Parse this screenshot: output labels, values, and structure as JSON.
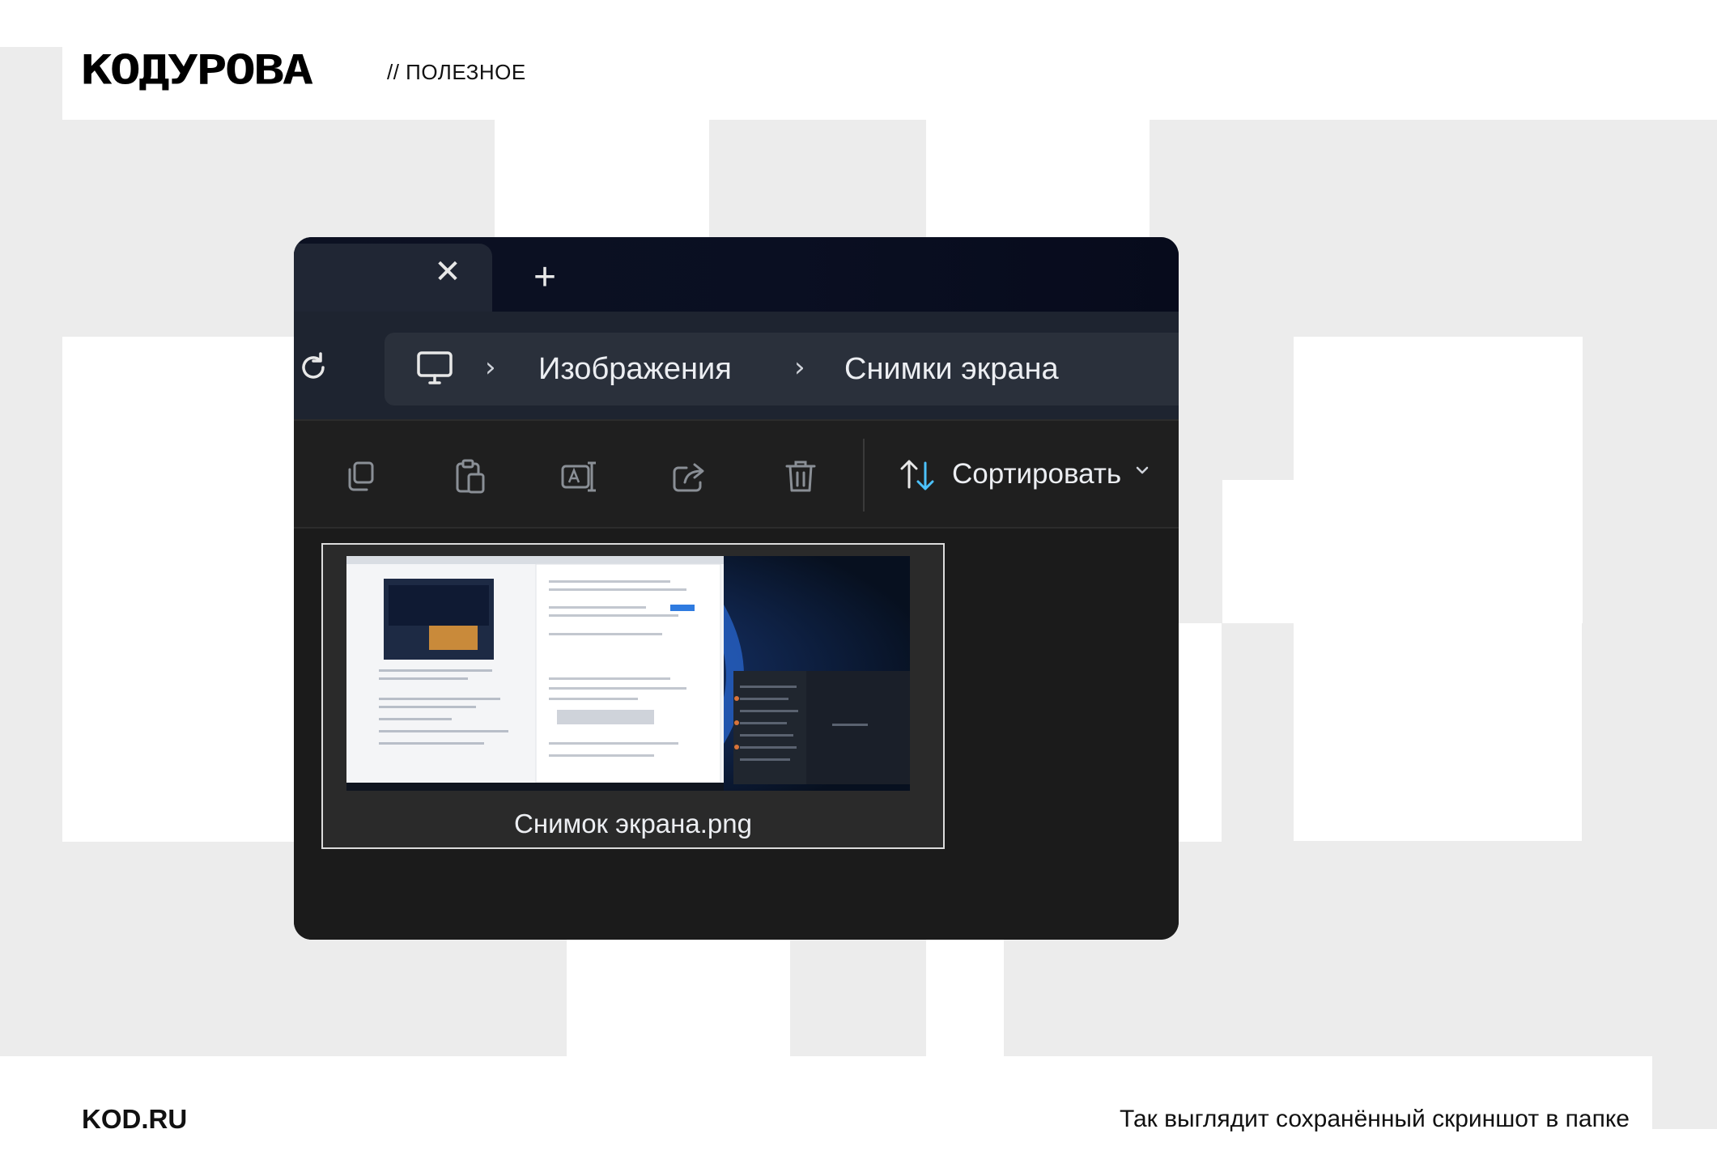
{
  "header": {
    "logo": "КОДУРОВА",
    "section": "// ПОЛЕЗНОЕ"
  },
  "footer": {
    "site": "KOD.RU",
    "caption": "Так выглядит сохранённый скриншот в папке"
  },
  "explorer": {
    "tab": {
      "close_icon": "close-icon"
    },
    "new_tab_icon": "plus-icon",
    "breadcrumbs": [
      "Изображения",
      "Снимки экрана"
    ],
    "toolbar": {
      "tools": [
        "copy-icon",
        "paste-icon",
        "rename-icon",
        "share-icon",
        "delete-icon"
      ],
      "sort_label": "Сортировать"
    },
    "files": [
      {
        "name": "Снимок экрана.png"
      }
    ]
  },
  "colors": {
    "page_bg": "#ffffff",
    "pattern_gray": "#ececec",
    "window_bg": "#1c1c1c",
    "titlebar": "#0a0f22",
    "accent_blue": "#4cc2ff"
  }
}
